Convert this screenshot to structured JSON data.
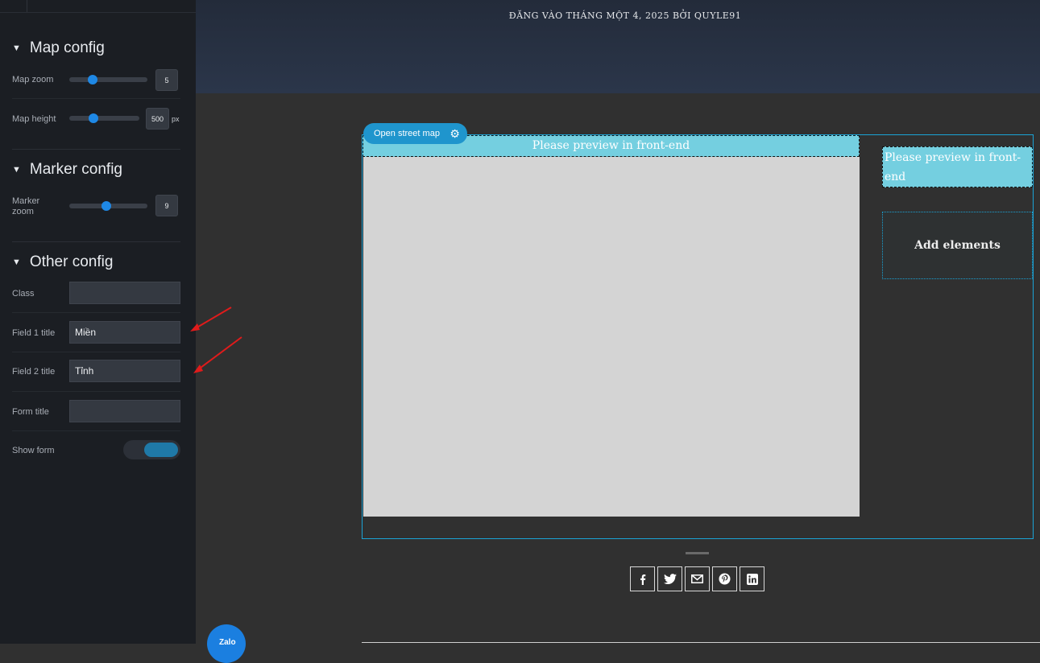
{
  "sidebar": {
    "map_config": {
      "title": "Map config",
      "zoom_label": "Map zoom",
      "zoom_value": "5",
      "zoom_level": 0.3,
      "height_label": "Map height",
      "height_value": "500",
      "height_unit": "px",
      "height_level": 0.35
    },
    "marker_config": {
      "title": "Marker config",
      "zoom_label": "Marker zoom",
      "zoom_value": "9",
      "zoom_level": 0.47
    },
    "other_config": {
      "title": "Other config",
      "class_label": "Class",
      "class_value": "",
      "field1_label": "Field 1 title",
      "field1_value": "Miền",
      "field2_label": "Field 2 title",
      "field2_value": "Tỉnh",
      "form_title_label": "Form title",
      "form_title_value": "",
      "show_form_label": "Show form",
      "show_form_on": true
    }
  },
  "header": {
    "meta": "ĐĂNG VÀO THÁNG MỘT 4, 2025 BỞI QUYLE91"
  },
  "map": {
    "tag_label": "Open street map",
    "banner": "Please preview in front-end",
    "side_box": "Please preview in front-end",
    "add_elements": "Add elements"
  },
  "share": {
    "icons": [
      "facebook-icon",
      "twitter-icon",
      "email-icon",
      "pinterest-icon",
      "linkedin-icon"
    ]
  },
  "zalo_label": "Zalo",
  "colors": {
    "accent": "#1f95cd",
    "banner": "#74cfe0",
    "annotation_arrow": "#e01b1b"
  }
}
